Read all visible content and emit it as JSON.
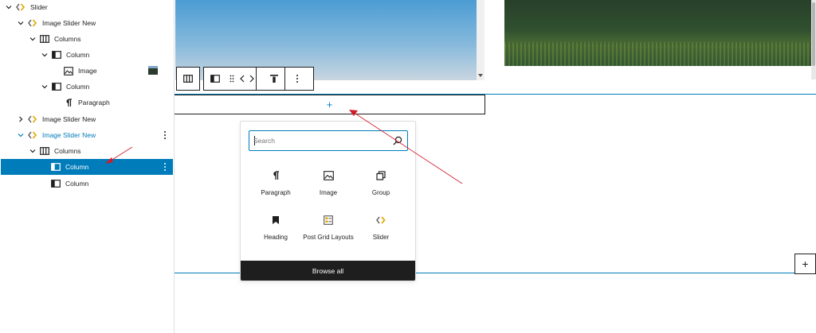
{
  "list_view": {
    "items": [
      {
        "label": "Slider"
      },
      {
        "label": "Image Slider New"
      },
      {
        "label": "Columns"
      },
      {
        "label": "Column"
      },
      {
        "label": "Image"
      },
      {
        "label": "Column"
      },
      {
        "label": "Paragraph"
      },
      {
        "label": "Image Slider New"
      },
      {
        "label": "Image Slider New"
      },
      {
        "label": "Columns"
      },
      {
        "label": "Column"
      },
      {
        "label": "Column"
      }
    ]
  },
  "appender": {
    "symbol": "+"
  },
  "inserter": {
    "search_placeholder": "Search",
    "blocks": [
      {
        "label": "Paragraph",
        "icon": "paragraph-icon"
      },
      {
        "label": "Image",
        "icon": "image-icon"
      },
      {
        "label": "Group",
        "icon": "group-icon"
      },
      {
        "label": "Heading",
        "icon": "heading-icon"
      },
      {
        "label": "Post Grid Layouts",
        "icon": "post-grid-icon"
      },
      {
        "label": "Slider",
        "icon": "slider-icon"
      }
    ],
    "browse_all": "Browse all"
  },
  "side_inserter": {
    "symbol": "+"
  },
  "colors": {
    "accent": "#007cba",
    "dark": "#1e1e1e",
    "annotation": "#d11a2a",
    "slider_brand_left": "#6a6a6a",
    "slider_brand_right": "#e2a400"
  }
}
